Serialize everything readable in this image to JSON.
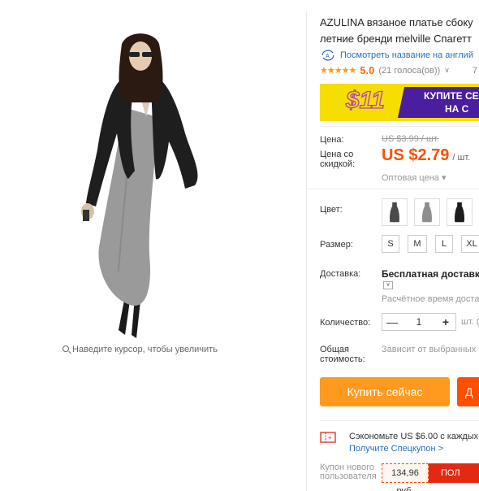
{
  "gallery": {
    "zoom_hint": "Наведите курсор, чтобы увеличить"
  },
  "product": {
    "title_line1": "AZULINA вязаное платье сбоку",
    "title_line2": "летние бренди melville Спагетт",
    "translate_link": "Посмотреть название на англий",
    "rating": {
      "stars": "★★★★★",
      "score": "5.0",
      "votes": "(21 голоса(ов))",
      "votes_chevron": "∨",
      "orders_fragment": "7"
    }
  },
  "banner": {
    "price": "$11",
    "text_line1": "КУПИТЕ СЕ",
    "text_line2": "НА С"
  },
  "pricing": {
    "price_label": "Цена:",
    "old_price": "US $3.99 / шт.",
    "discount_label_line1": "Цена со",
    "discount_label_line2": "скидкой:",
    "new_price": "US $2.79",
    "unit": "/ шт.",
    "wholesale": "Оптовая цена ▾"
  },
  "options": {
    "color_label": "Цвет:",
    "colors": [
      {
        "name": "dark-gray",
        "hex": "#4a4a4a"
      },
      {
        "name": "gray",
        "hex": "#8e8e8e"
      },
      {
        "name": "black",
        "hex": "#1c1c1c"
      }
    ],
    "size_label": "Размер:",
    "sizes": [
      "S",
      "M",
      "L",
      "XL"
    ]
  },
  "shipping": {
    "label": "Доставка:",
    "text": "Бесплатная доставка в",
    "chevron": "∨",
    "subtext": "Расчётное время доставк"
  },
  "quantity": {
    "label": "Количество:",
    "minus": "—",
    "value": "1",
    "plus": "+",
    "unit": "шт. (("
  },
  "total": {
    "label_line1": "Общая",
    "label_line2": "стоимость:",
    "text": "Зависит от выбранных"
  },
  "actions": {
    "buy_now": "Купить сейчас",
    "add_to_cart": "Д"
  },
  "coupon": {
    "save_text": "Сэкономьте US $6.00 с каждых",
    "get_link": "Получите Спецкупон >",
    "new_user_label_line1": "Купон нового",
    "new_user_label_line2": "пользователя",
    "value": "134,96 руб.",
    "get_button": "ПОЛ"
  },
  "colors": {
    "accent_orange": "#ff9a1f",
    "price_red": "#ff4e00",
    "link_blue": "#2a6ebb",
    "star_orange": "#ff9a00",
    "banner_yellow": "#f5de00",
    "banner_purple": "#4a1e9e"
  }
}
